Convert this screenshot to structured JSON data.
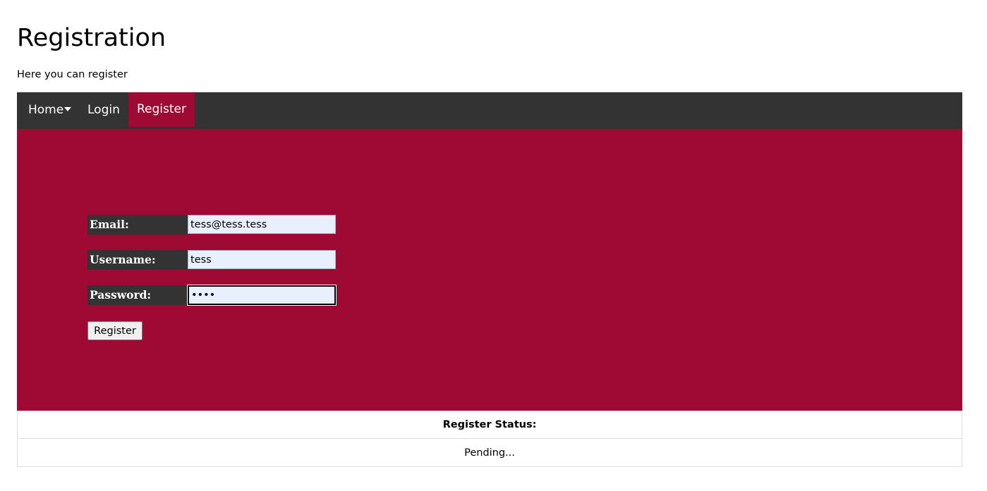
{
  "header": {
    "title": "Registration",
    "subtitle": "Here you can register"
  },
  "nav": {
    "home_label": "Home",
    "login_label": "Login",
    "register_label": "Register",
    "active": "Register",
    "bg_color": "#333333",
    "active_color": "#9e0a33"
  },
  "form": {
    "panel_color": "#9e0a33",
    "email_label": "Email:",
    "email_value": "tess@tess.tess",
    "username_label": "Username:",
    "username_value": "tess",
    "password_label": "Password:",
    "password_value": "tess",
    "submit_label": "Register"
  },
  "status": {
    "header": "Register Status:",
    "value": "Pending..."
  }
}
